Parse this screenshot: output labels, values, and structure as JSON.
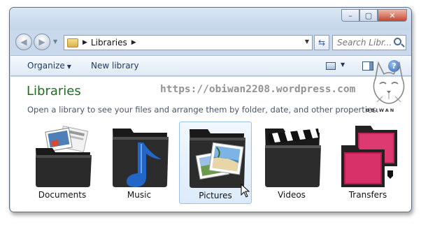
{
  "window": {
    "caption_buttons": {
      "minimize": "–",
      "maximize": "▢",
      "close": "✕"
    }
  },
  "nav": {
    "back_glyph": "◀",
    "forward_glyph": "▶",
    "address": {
      "separator": "▶",
      "path": "Libraries",
      "end_separator": "▶"
    },
    "refresh_glyph": "⇆",
    "search": {
      "placeholder": "Search Libr..."
    }
  },
  "toolbar": {
    "organize_label": "Organize",
    "new_library_label": "New library",
    "help_glyph": "?"
  },
  "content": {
    "title": "Libraries",
    "subtitle": "Open a library to see your files and arrange them by folder, date, and other properties.",
    "watermark": "https://obiwan2208.wordpress.com",
    "watermark_logo_text": "OBIWAN",
    "libraries": [
      {
        "label": "Documents",
        "icon": "documents-folder-icon"
      },
      {
        "label": "Music",
        "icon": "music-folder-icon"
      },
      {
        "label": "Pictures",
        "icon": "pictures-folder-icon",
        "selected": true
      },
      {
        "label": "Videos",
        "icon": "videos-folder-icon"
      },
      {
        "label": "Transfers",
        "icon": "transfers-folder-icon"
      }
    ]
  },
  "colors": {
    "title_green": "#1e6e1e",
    "selection_blue": "#dcebfb",
    "folder_black": "#1a1a1a"
  }
}
